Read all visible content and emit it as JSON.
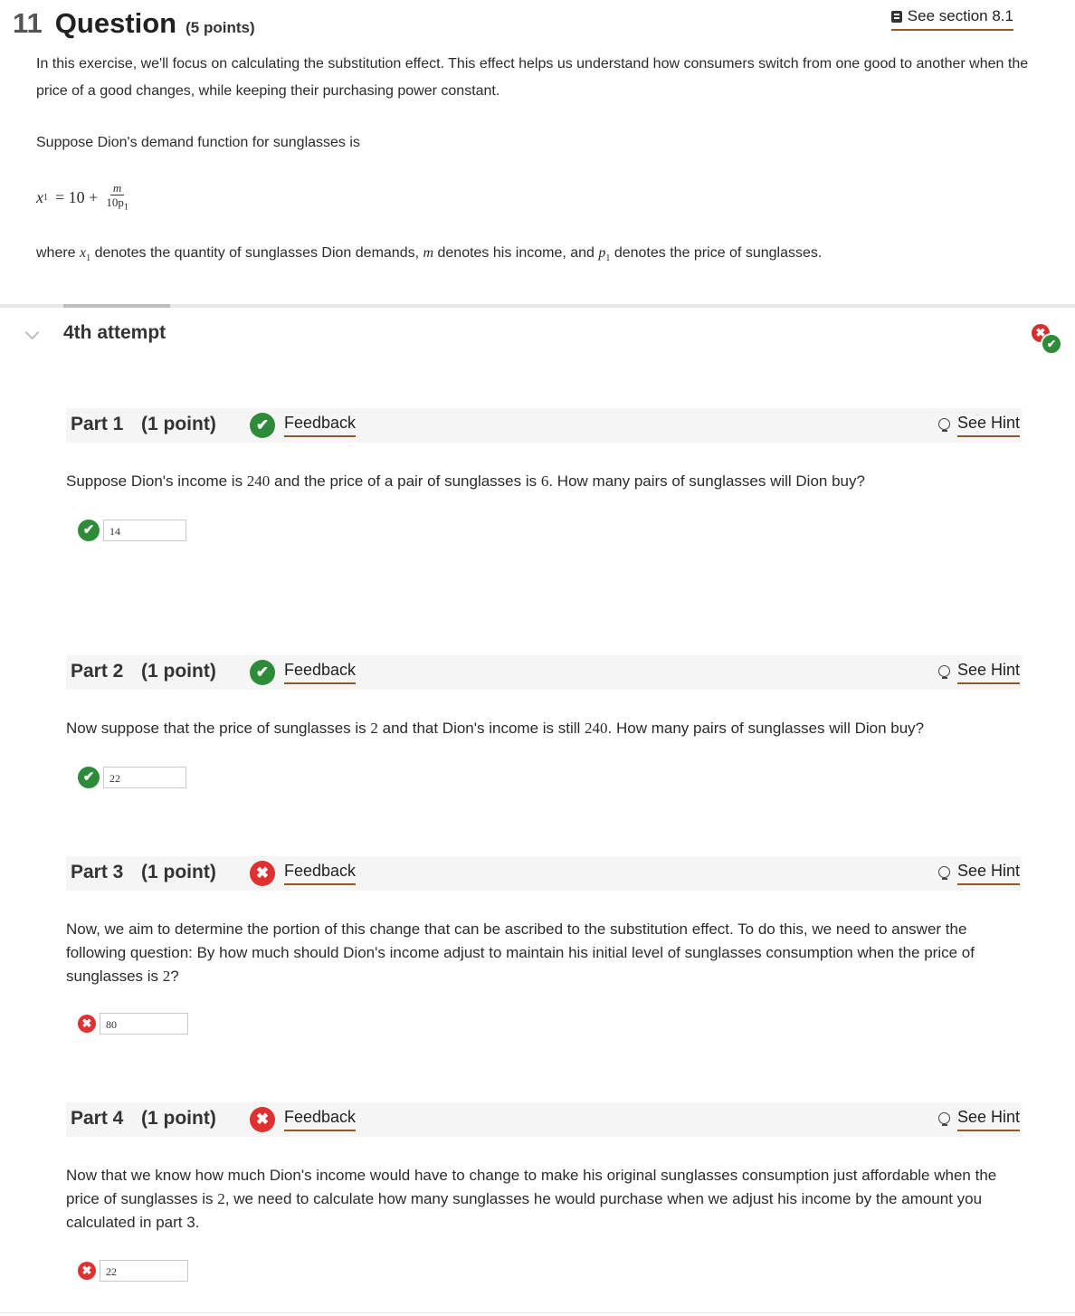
{
  "question": {
    "number": "11",
    "word": "Question",
    "points": "(5 points)",
    "see_section": "See section 8.1",
    "intro": "In this exercise, we'll focus on calculating the substitution effect. This effect helps us understand how consumers switch from one good to another when the price of a good changes, while keeping their purchasing power constant.",
    "demand_intro": "Suppose Dion's demand function for sunglasses is",
    "formula": {
      "lhs": "x",
      "lhs_sub": "1",
      "eq": "= 10 +",
      "num": "m",
      "den": "10p",
      "den_sub": "1"
    },
    "where": {
      "t1": "where ",
      "v1": "x",
      "v1_sub": "1",
      "t2": " denotes the quantity of sunglasses Dion demands, ",
      "v2": "m",
      "t3": " denotes his income, and ",
      "v3": "p",
      "v3_sub": "1",
      "t4": " denotes the price of sunglasses."
    }
  },
  "attempt": {
    "label": "4th attempt",
    "status_icons": [
      "x-icon",
      "check-icon"
    ]
  },
  "parts": [
    {
      "title": "Part 1",
      "points": "(1 point)",
      "status": "correct",
      "status_glyph": "✔",
      "feedback": "Feedback",
      "hint": "See Hint",
      "q": {
        "t1": "Suppose Dion's income is ",
        "n1": "240",
        "t2": " and the price of a pair of sunglasses is ",
        "n2": "6",
        "t3": ". How many pairs of sunglasses will Dion buy?"
      },
      "answer": "14"
    },
    {
      "title": "Part 2",
      "points": "(1 point)",
      "status": "correct",
      "status_glyph": "✔",
      "feedback": "Feedback",
      "hint": "See Hint",
      "q": {
        "t1": "Now suppose that the price of sunglasses is ",
        "n1": "2",
        "t2": " and that Dion's income is still ",
        "n2": "240",
        "t3": ". How many pairs of sunglasses will Dion buy?"
      },
      "answer": "22"
    },
    {
      "title": "Part 3",
      "points": "(1 point)",
      "status": "incorrect",
      "status_glyph": "✖",
      "feedback": "Feedback",
      "hint": "See Hint",
      "q": {
        "t1": "Now, we aim to determine the portion of this change that can be ascribed to the substitution effect. To do this, we need to answer the following question: By how much should Dion's income adjust to maintain his initial level of sunglasses consumption when the price of sunglasses is ",
        "n1": "2",
        "t2": "?"
      },
      "answer": "80"
    },
    {
      "title": "Part 4",
      "points": "(1 point)",
      "status": "incorrect",
      "status_glyph": "✖",
      "feedback": "Feedback",
      "hint": "See Hint",
      "q": {
        "t1": "Now that we know how much Dion's income would have to change to make his original sunglasses consumption just affordable when the price of sunglasses is ",
        "n1": "2",
        "t2": ", we need to calculate how many sunglasses he would purchase when we adjust his income by the amount you calculated in part 3."
      },
      "answer": "22"
    }
  ],
  "colors": {
    "correct": "#2e8b3a",
    "incorrect": "#e03131",
    "link_underline": "#8b5a2b",
    "part_bar_bg": "#f5f5f5"
  }
}
